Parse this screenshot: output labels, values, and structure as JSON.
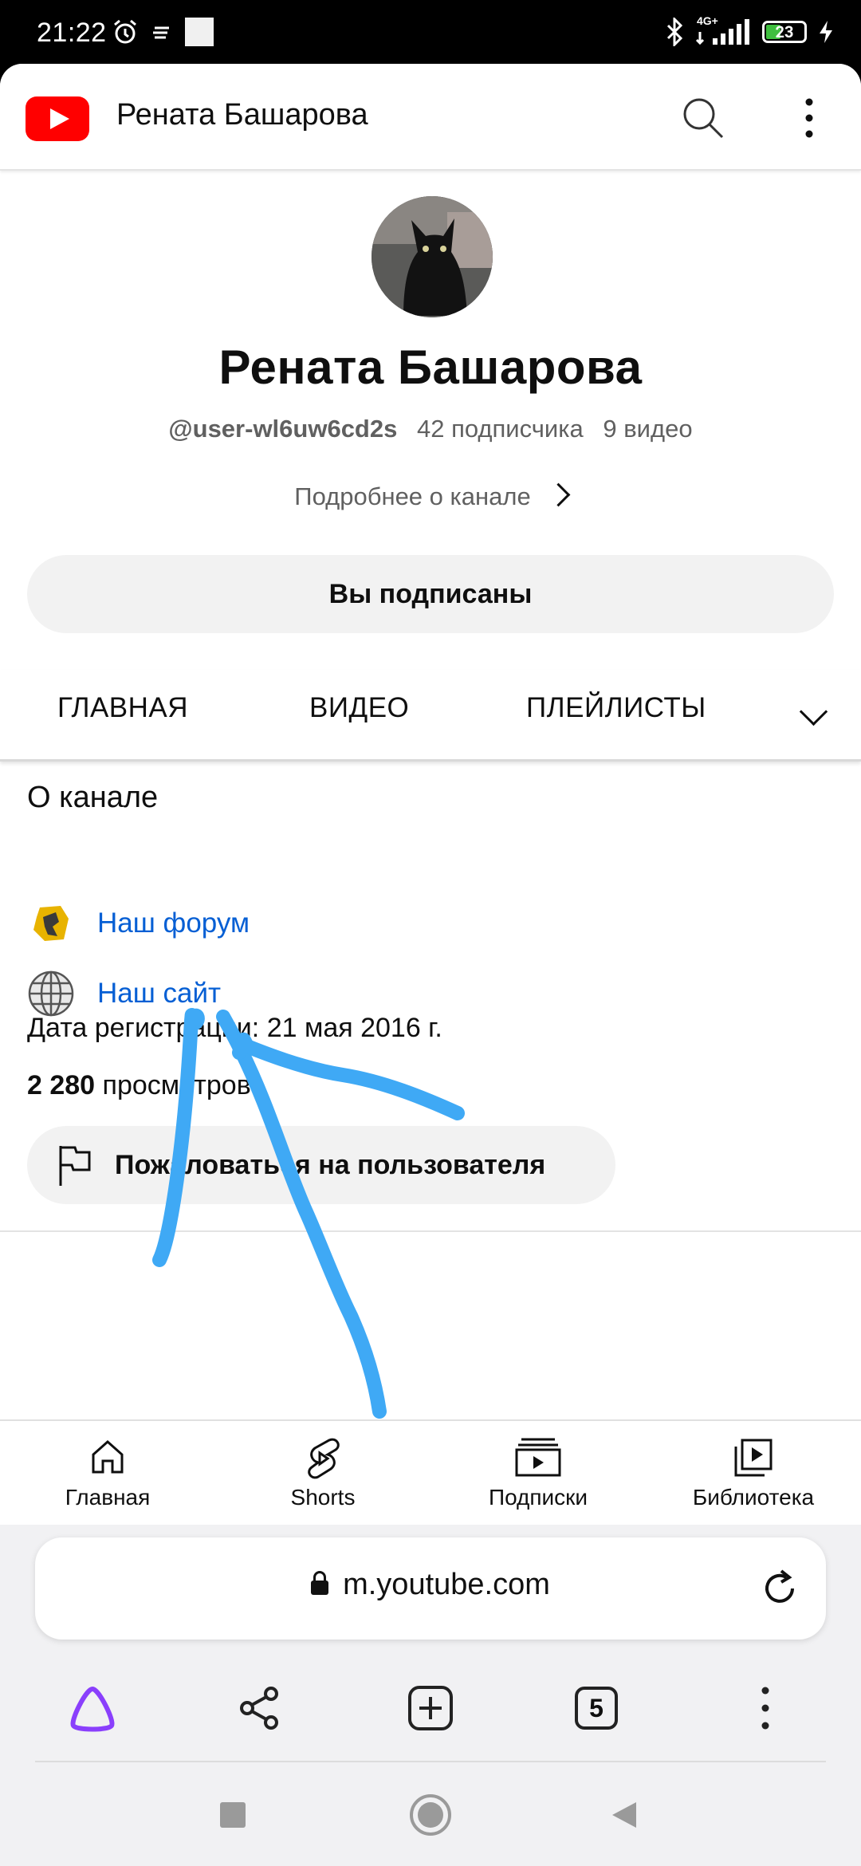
{
  "status_bar": {
    "time": "21:22",
    "network": "4G+",
    "battery": "23"
  },
  "header": {
    "title": "Рената Башарова",
    "icons": [
      "youtube-logo",
      "search-icon",
      "more-vert-icon"
    ]
  },
  "channel": {
    "name": "Рената Башарова",
    "handle": "@user-wl6uw6cd2s",
    "subscribers": "42 подписчика",
    "videos": "9 видео",
    "more_about": "Подробнее о канале",
    "subscribe_button": "Вы подписаны"
  },
  "tabs": {
    "items": [
      "ГЛАВНАЯ",
      "ВИДЕО",
      "ПЛЕЙЛИСТЫ"
    ]
  },
  "about": {
    "heading": "О канале",
    "links": [
      {
        "label": "Наш форум",
        "icon": "forum-favicon-icon"
      },
      {
        "label": "Наш сайт",
        "icon": "globe-icon"
      }
    ],
    "registration": "Дата регистрации: 21 мая 2016 г.",
    "views_count": "2 280",
    "views_label": " просмотров",
    "report_button": "Пожаловаться на пользователя"
  },
  "bottom_nav": {
    "items": [
      {
        "label": "Главная",
        "icon": "home-icon"
      },
      {
        "label": "Shorts",
        "icon": "shorts-icon"
      },
      {
        "label": "Подписки",
        "icon": "subscriptions-icon"
      },
      {
        "label": "Библиотека",
        "icon": "library-icon"
      }
    ]
  },
  "browser": {
    "url": "m.youtube.com",
    "tab_count": "5"
  },
  "colors": {
    "link": "#065fd4",
    "youtube_red": "#ff0000",
    "scribble": "#3fa9f5",
    "alice_purple": "#8a3ffc"
  }
}
